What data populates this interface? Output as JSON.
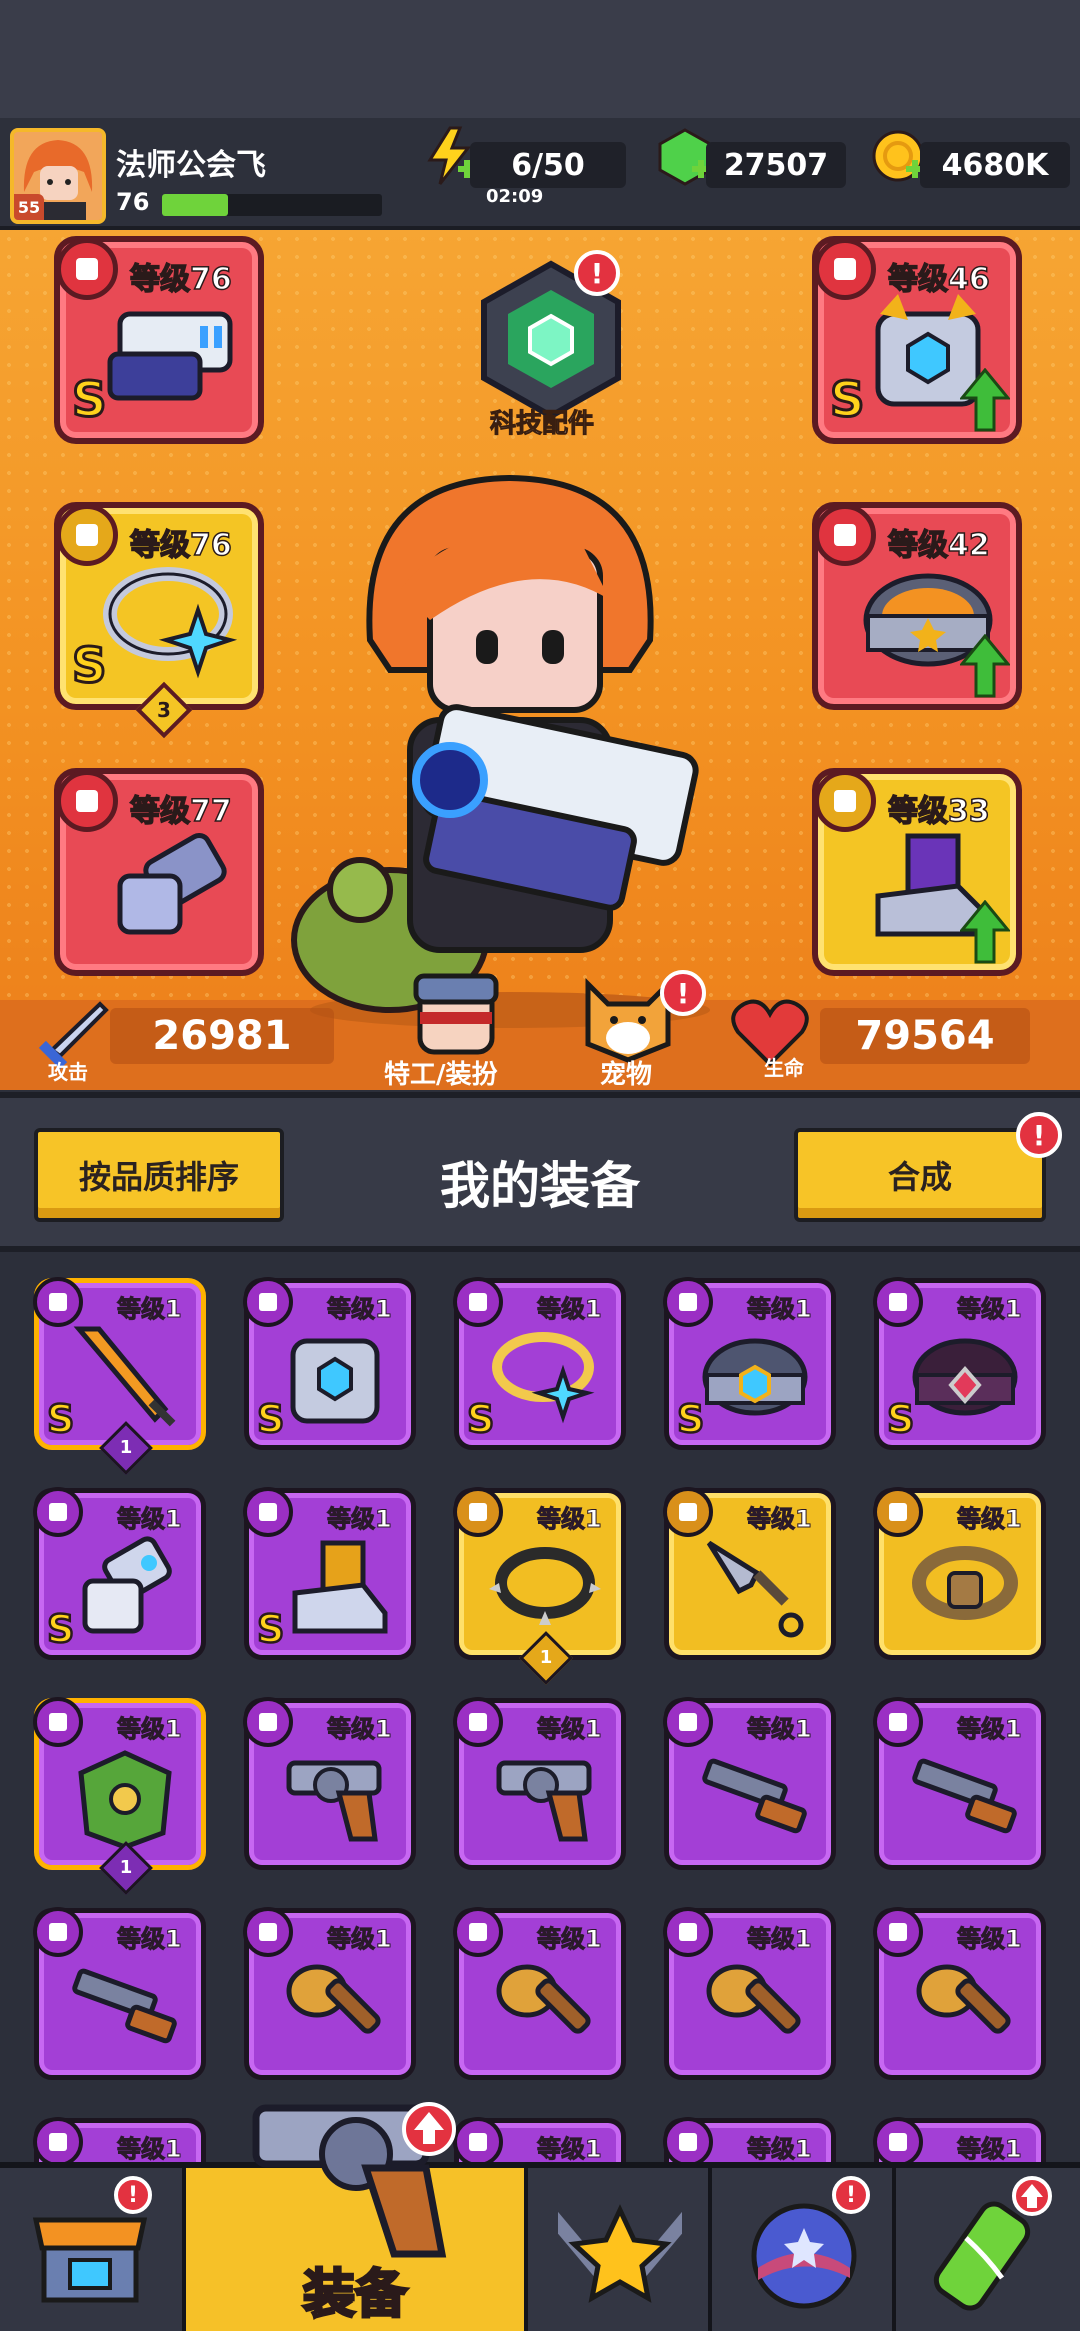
{
  "header": {
    "avatar_level": "55",
    "player_name": "法师公会飞",
    "player_level": "76",
    "xp_fraction": 0.3,
    "energy": "6/50",
    "energy_timer": "02:09",
    "gems": "27507",
    "gold": "4680K"
  },
  "hero": {
    "tech_label": "科技配件",
    "slots": {
      "weapon": {
        "level": "等级76",
        "grade": "S"
      },
      "armor": {
        "level": "等级46",
        "grade": "S"
      },
      "necklace": {
        "level": "等级76",
        "grade": "S",
        "stars": "3"
      },
      "belt": {
        "level": "等级42"
      },
      "gloves": {
        "level": "等级77"
      },
      "boots": {
        "level": "等级33"
      }
    },
    "attack_label": "攻击",
    "attack_value": "26981",
    "agent_label": "特工/装扮",
    "pet_label": "宠物",
    "hp_label": "生命",
    "hp_value": "79564"
  },
  "equipment_bar": {
    "sort_button": "按品质排序",
    "title": "我的装备",
    "merge_button": "合成"
  },
  "inventory": {
    "cell_level": "等级1",
    "stars_one": "1"
  },
  "nav": {
    "equip_label": "装备"
  },
  "colors": {
    "accent_yellow": "#f7c427",
    "hero_orange": "#f39222",
    "rarity_purple": "#a33fd6",
    "rarity_red": "#e84a55",
    "badge_red": "#e33240"
  }
}
